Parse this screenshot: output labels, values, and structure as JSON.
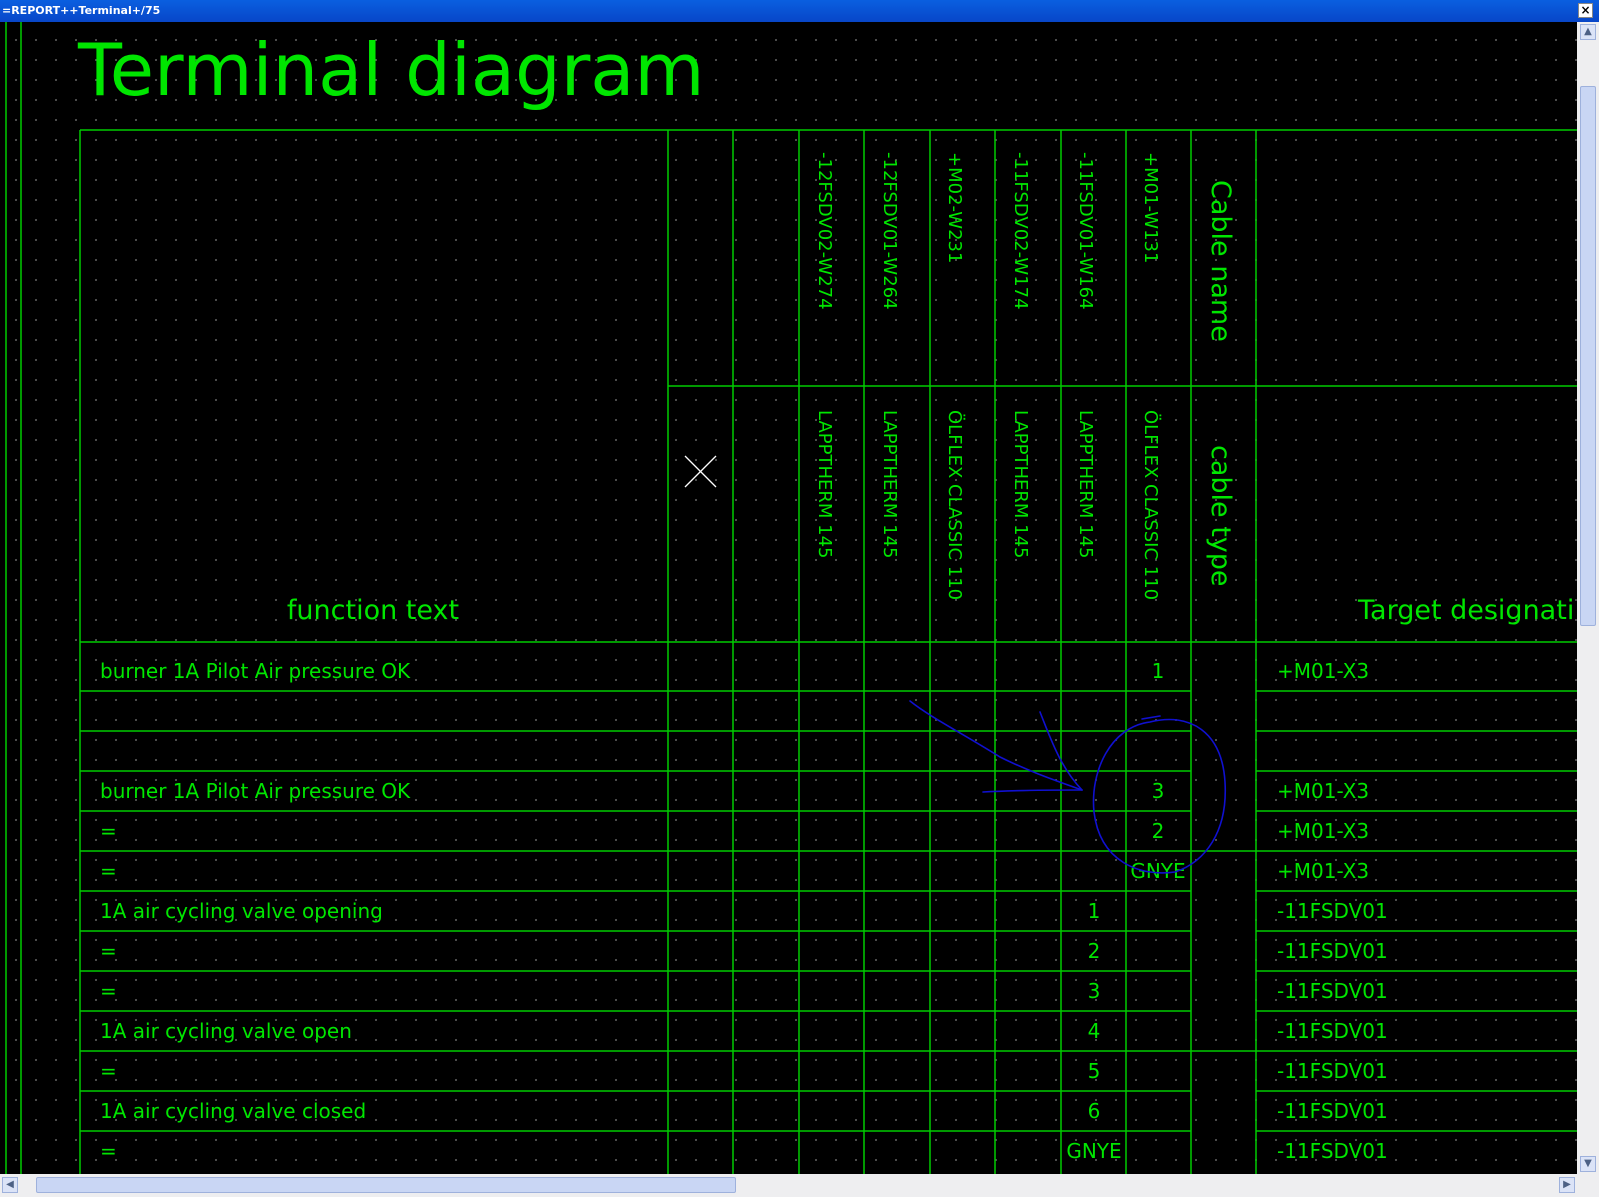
{
  "window": {
    "title": "=REPORT++Terminal+/75"
  },
  "page": {
    "title": "Terminal diagram"
  },
  "columns": {
    "cables": [
      {
        "name": "-12FSDV02-W274",
        "type": "LAPPTHERM 145"
      },
      {
        "name": "-12FSDV01-W264",
        "type": "LAPPTHERM 145"
      },
      {
        "name": "+M02-W231",
        "type": "ÖLFLEX CLASSIC 110"
      },
      {
        "name": "-11FSDV02-W174",
        "type": "LAPPTHERM 145"
      },
      {
        "name": "-11FSDV01-W164",
        "type": "LAPPTHERM 145"
      },
      {
        "name": "+M01-W131",
        "type": "ÖLFLEX CLASSIC 110"
      }
    ],
    "cable_name_header": "Cable name",
    "cable_type_header": "cable type",
    "function_text_header": "function text",
    "target_header": "Target designati"
  },
  "rows": [
    {
      "function": "burner 1A Pilot Air pressure OK",
      "w164": "",
      "w131": "1",
      "target": "+M01-X3"
    },
    {
      "function": "",
      "w164": "",
      "w131": "",
      "target": ""
    },
    {
      "function": "",
      "w164": "",
      "w131": "",
      "target": ""
    },
    {
      "function": "burner 1A Pilot Air pressure OK",
      "w164": "",
      "w131": "3",
      "target": "+M01-X3"
    },
    {
      "function": "=",
      "w164": "",
      "w131": "2",
      "target": "+M01-X3"
    },
    {
      "function": "=",
      "w164": "",
      "w131": "GNYE",
      "target": "+M01-X3"
    },
    {
      "function": "1A air cycling valve opening",
      "w164": "1",
      "w131": "",
      "target": "-11FSDV01"
    },
    {
      "function": "=",
      "w164": "2",
      "w131": "",
      "target": "-11FSDV01"
    },
    {
      "function": "=",
      "w164": "3",
      "w131": "",
      "target": "-11FSDV01"
    },
    {
      "function": "1A air cycling valve open",
      "w164": "4",
      "w131": "",
      "target": "-11FSDV01"
    },
    {
      "function": "=",
      "w164": "5",
      "w131": "",
      "target": "-11FSDV01"
    },
    {
      "function": "1A air cycling valve closed",
      "w164": "6",
      "w131": "",
      "target": "-11FSDV01"
    },
    {
      "function": "=",
      "w164": "GNYE",
      "w131": "",
      "target": "-11FSDV01"
    }
  ],
  "colors": {
    "line": "#00cc00",
    "text": "#00e600",
    "annotation": "#1010d0"
  },
  "icons": {
    "x_mark": "x-mark-icon"
  }
}
